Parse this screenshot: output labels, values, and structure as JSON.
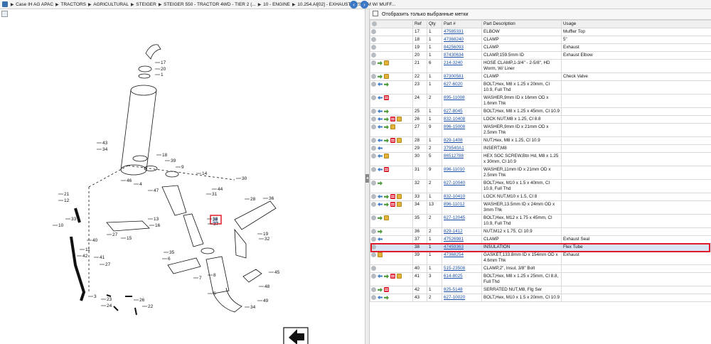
{
  "breadcrumb": [
    "Case IH AG APAC",
    "TRACTORS",
    "AGRICULTURAL",
    "STEIGER",
    "STEIGER 550 - TRACTOR 4WD - TIER 2 (...",
    "10 - ENGINE",
    "10.254.AI[02] - EXHAUST SYSTEM W/ MUFF..."
  ],
  "filter_label": "Отобразить только выбранные метки",
  "columns": [
    "Ref",
    "Qty",
    "Part #",
    "Part Description",
    "Usage"
  ],
  "diagram": {
    "highlight_label": "38",
    "callouts": [
      "17",
      "20",
      "1",
      "43",
      "34",
      "18",
      "39",
      "9",
      "14",
      "31",
      "44",
      "46",
      "4",
      "47",
      "21",
      "12",
      "33",
      "10",
      "11",
      "42",
      "40",
      "41",
      "27",
      "3",
      "23",
      "24",
      "26",
      "22",
      "13",
      "16",
      "15",
      "37",
      "38",
      "30",
      "28",
      "36",
      "29",
      "32",
      "35",
      "6",
      "7",
      "8",
      "5",
      "19",
      "45",
      "48",
      "49",
      "34",
      "27"
    ]
  },
  "rows": [
    {
      "icons": [
        "g"
      ],
      "ref": "17",
      "qty": "1",
      "part": "47585331",
      "desc": "ELBOW",
      "usage": "Muffler Top"
    },
    {
      "icons": [
        "g"
      ],
      "ref": "18",
      "qty": "1",
      "part": "47368240",
      "desc": "CLAMP",
      "usage": "5\""
    },
    {
      "icons": [
        "g"
      ],
      "ref": "19",
      "qty": "1",
      "part": "84256093",
      "desc": "CLAMP",
      "usage": "Exhaust"
    },
    {
      "icons": [
        "g"
      ],
      "ref": "20",
      "qty": "1",
      "part": "87430634",
      "desc": "CLAMP,159.5mm ID",
      "usage": "Exhaust Elbow"
    },
    {
      "icons": [
        "g",
        "a",
        "p"
      ],
      "ref": "21",
      "qty": "6",
      "part": "214-3240",
      "desc": "HOSE CLAMP,1-3/4\" - 2-5/8\", HD Worm, W/ Liner",
      "usage": ""
    },
    {
      "icons": [
        "g",
        "a",
        "p"
      ],
      "ref": "22",
      "qty": "1",
      "part": "87300581",
      "desc": "CLAMP",
      "usage": "Check Valve"
    },
    {
      "icons": [
        "g",
        "b",
        "a"
      ],
      "ref": "23",
      "qty": "1",
      "part": "627-6020",
      "desc": "BOLT,Hex, M8 x 1.25 x 20mm, Cl 10.9, Full Thd",
      "usage": ""
    },
    {
      "icons": [
        "g",
        "b",
        "r"
      ],
      "ref": "24",
      "qty": "2",
      "part": "895-11008",
      "desc": "WASHER,9mm ID x 16mm OD x 1.6mm Thk",
      "usage": ""
    },
    {
      "icons": [
        "g",
        "b",
        "a"
      ],
      "ref": "25",
      "qty": "1",
      "part": "627-8045",
      "desc": "BOLT,Hex, M8 x 1.25 x 45mm, Cl 10.9",
      "usage": ""
    },
    {
      "icons": [
        "g",
        "b",
        "a",
        "r",
        "p"
      ],
      "ref": "26",
      "qty": "1",
      "part": "832-10408",
      "desc": "LOCK NUT,M8 x 1.25, Cl 8.8",
      "usage": ""
    },
    {
      "icons": [
        "g",
        "b",
        "a",
        "p"
      ],
      "ref": "27",
      "qty": "9",
      "part": "896-15008",
      "desc": "WASHER,9mm ID x 21mm OD x 2.5mm Thk",
      "usage": ""
    },
    {
      "icons": [
        "g",
        "b",
        "a",
        "r",
        "p"
      ],
      "ref": "28",
      "qty": "1",
      "part": "829-1408",
      "desc": "NUT,Hex, M8 x 1.25, Cl 10.9",
      "usage": ""
    },
    {
      "icons": [
        "g",
        "b"
      ],
      "ref": "29",
      "qty": "2",
      "part": "379540A1",
      "desc": "INSERT,M8",
      "usage": ""
    },
    {
      "icons": [
        "g",
        "b",
        "p"
      ],
      "ref": "30",
      "qty": "5",
      "part": "86512788",
      "desc": "HEX SOC SCREW,Btn Hd, M8 x 1.25 x 30mm, Cl 10.9",
      "usage": ""
    },
    {
      "icons": [
        "g",
        "b",
        "r"
      ],
      "ref": "31",
      "qty": "9",
      "part": "896-11010",
      "desc": "WASHER,11mm ID x 21mm OD x 2.5mm Thk",
      "usage": ""
    },
    {
      "icons": [
        "g",
        "a"
      ],
      "ref": "32",
      "qty": "2",
      "part": "627-10040",
      "desc": "BOLT,Hex, M10 x 1.5 x 40mm, Cl 10.9, Full Thd",
      "usage": ""
    },
    {
      "icons": [
        "g",
        "b",
        "a",
        "r",
        "p"
      ],
      "ref": "33",
      "qty": "1",
      "part": "832-10410",
      "desc": "LOCK NUT,M10 x 1.5, Cl 8",
      "usage": ""
    },
    {
      "icons": [
        "g",
        "b",
        "a",
        "r",
        "p"
      ],
      "ref": "34",
      "qty": "13",
      "part": "896-11012",
      "desc": "WASHER,13.5mm ID x 24mm OD x 3mm Thk",
      "usage": ""
    },
    {
      "icons": [
        "g",
        "a",
        "p"
      ],
      "ref": "35",
      "qty": "2",
      "part": "627-12045",
      "desc": "BOLT,Hex, M12 x 1.75 x 45mm, Cl 10.9, Full Thd",
      "usage": ""
    },
    {
      "icons": [
        "g",
        "a"
      ],
      "ref": "36",
      "qty": "2",
      "part": "829-1412",
      "desc": "NUT,M12 x 1.75, Cl 10.9",
      "usage": ""
    },
    {
      "icons": [
        "g",
        "b"
      ],
      "ref": "37",
      "qty": "1",
      "part": "47526981",
      "desc": "CLAMP",
      "usage": "Exhaust Seal"
    },
    {
      "icons": [
        "g"
      ],
      "ref": "38",
      "qty": "1",
      "part": "47459363",
      "desc": "INSULATION",
      "usage": "Flex Tube",
      "selected": true
    },
    {
      "icons": [
        "g",
        "p"
      ],
      "ref": "39",
      "qty": "1",
      "part": "47368254",
      "desc": "GASKET,133.8mm ID x 154mm OD x 4.6mm Thk",
      "usage": "Exhaust"
    },
    {
      "icons": [
        "g"
      ],
      "ref": "40",
      "qty": "1",
      "part": "515-23508",
      "desc": "CLAMP,2\", Insul, 3/8\" Bolt",
      "usage": ""
    },
    {
      "icons": [
        "g",
        "b",
        "a",
        "r",
        "p"
      ],
      "ref": "41",
      "qty": "3",
      "part": "614-8025",
      "desc": "BOLT,Hex, M8 x 1.25 x 25mm, Cl 8.8, Full Thd",
      "usage": ""
    },
    {
      "icons": [
        "g",
        "a",
        "r"
      ],
      "ref": "42",
      "qty": "1",
      "part": "825-5148",
      "desc": "SERRATED NUT,M8, Flg Ser",
      "usage": ""
    },
    {
      "icons": [
        "g",
        "b",
        "a"
      ],
      "ref": "43",
      "qty": "2",
      "part": "627-10020",
      "desc": "BOLT,Hex, M10 x 1.5 x 20mm, Cl 10.9",
      "usage": ""
    }
  ]
}
